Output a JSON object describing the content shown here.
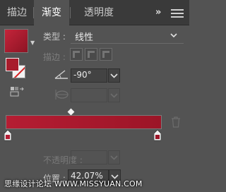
{
  "tabs": [
    {
      "label": "描边",
      "active": false
    },
    {
      "label": "渐变",
      "active": true
    },
    {
      "label": "透明度",
      "active": false
    }
  ],
  "toolbar": {
    "more_label": "»",
    "menu_icon": "panel-menu-icon"
  },
  "gradient": {
    "type_label": "类型 :",
    "type_value": "线性",
    "stroke_label": "描边 :",
    "angle_value": "-90°",
    "opacity_label": "不透明度 :",
    "location_label": "位置 :",
    "location_value": "42.07%",
    "colors": {
      "start": "#b51d33",
      "end": "#9c1527",
      "fill": "#a81c2c"
    }
  },
  "watermark": "思缘设计论坛  WWW.MISSYUAN.COM",
  "icons": {
    "dropdown": "chevron-down-icon",
    "angle": "angle-icon",
    "aspect": "aspect-ratio-icon",
    "reverse": "reverse-gradient-icon",
    "trash": "trash-icon",
    "stop": "color-stop-icon"
  }
}
